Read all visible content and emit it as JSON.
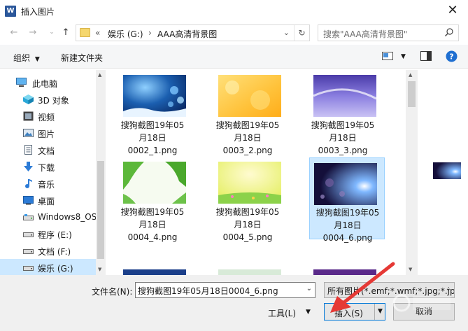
{
  "window": {
    "title": "插入图片",
    "app_icon": "word-icon",
    "close_glyph": "✕"
  },
  "address": {
    "breadcrumb": [
      "«",
      "娱乐 (G:)",
      "›",
      "AAA高清背景图"
    ],
    "search_placeholder": "搜索\"AAA高清背景图\""
  },
  "toolbar": {
    "organize_label": "组织",
    "new_folder_label": "新建文件夹",
    "help_glyph": "?"
  },
  "nav": {
    "items": [
      {
        "label": "此电脑",
        "icon": "computer-icon"
      },
      {
        "label": "3D 对象",
        "icon": "cube-icon"
      },
      {
        "label": "视频",
        "icon": "film-icon"
      },
      {
        "label": "图片",
        "icon": "picture-icon"
      },
      {
        "label": "文档",
        "icon": "document-icon"
      },
      {
        "label": "下载",
        "icon": "download-icon"
      },
      {
        "label": "音乐",
        "icon": "music-icon"
      },
      {
        "label": "桌面",
        "icon": "desktop-icon"
      },
      {
        "label": "Windows8_OS",
        "icon": "drive-icon"
      },
      {
        "label": "程序 (E:)",
        "icon": "drive-icon"
      },
      {
        "label": "文档 (F:)",
        "icon": "drive-icon"
      },
      {
        "label": "娱乐 (G:)",
        "icon": "drive-icon"
      }
    ]
  },
  "files": [
    {
      "line1": "搜狗截图19年05",
      "line2": "月18日",
      "line3": "0002_1.png"
    },
    {
      "line1": "搜狗截图19年05",
      "line2": "月18日",
      "line3": "0003_2.png"
    },
    {
      "line1": "搜狗截图19年05",
      "line2": "月18日",
      "line3": "0003_3.png"
    },
    {
      "line1": "搜狗截图19年05",
      "line2": "月18日",
      "line3": "0004_4.png"
    },
    {
      "line1": "搜狗截图19年05",
      "line2": "月18日",
      "line3": "0004_5.png"
    },
    {
      "line1": "搜狗截图19年05",
      "line2": "月18日",
      "line3": "0004_6.png"
    }
  ],
  "bottom": {
    "filename_label": "文件名(N):",
    "filename_value": "搜狗截图19年05月18日0004_6.png",
    "filter_value": "所有图片(*.emf;*.wmf;*.jpg;*.jp",
    "tools_label": "工具(L)",
    "insert_label": "插入(S)",
    "cancel_label": "取消"
  },
  "colors": {
    "selection": "#cce8ff",
    "accent": "#0078d7",
    "annotation_arrow": "#e53935"
  }
}
